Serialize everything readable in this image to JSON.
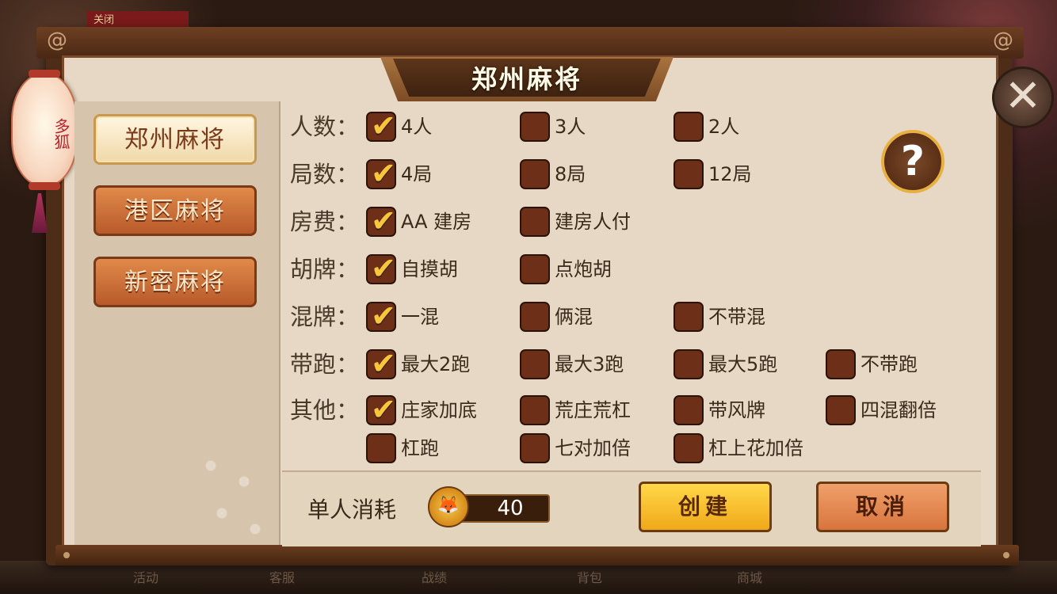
{
  "background": {
    "corner_tab": "关闭",
    "bottom_nav": [
      "活动",
      "客服",
      "战绩",
      "背包",
      "商城"
    ]
  },
  "lantern": {
    "text": "多狐"
  },
  "panel": {
    "title": "郑州麻将",
    "close_symbol": "✕",
    "help_symbol": "?"
  },
  "sidebar": {
    "games": [
      {
        "label": "郑州麻将",
        "active": true
      },
      {
        "label": "港区麻将",
        "active": false
      },
      {
        "label": "新密麻将",
        "active": false
      }
    ]
  },
  "options": [
    {
      "label": "人数：",
      "choices": [
        "4人",
        "3人",
        "2人"
      ],
      "checked": [
        true,
        false,
        false
      ]
    },
    {
      "label": "局数：",
      "choices": [
        "4局",
        "8局",
        "12局"
      ],
      "checked": [
        true,
        false,
        false
      ]
    },
    {
      "label": "房费：",
      "choices": [
        "AA 建房",
        "建房人付"
      ],
      "checked": [
        true,
        false
      ]
    },
    {
      "label": "胡牌：",
      "choices": [
        "自摸胡",
        "点炮胡"
      ],
      "checked": [
        true,
        false
      ]
    },
    {
      "label": "混牌：",
      "choices": [
        "一混",
        "俩混",
        "不带混"
      ],
      "checked": [
        true,
        false,
        false
      ]
    },
    {
      "label": "带跑：",
      "choices": [
        "最大2跑",
        "最大3跑",
        "最大5跑",
        "不带跑"
      ],
      "checked": [
        true,
        false,
        false,
        false
      ]
    },
    {
      "label": "其他：",
      "choices": [
        "庄家加底",
        "荒庄荒杠",
        "带风牌",
        "四混翻倍"
      ],
      "checked": [
        true,
        false,
        false,
        false
      ]
    },
    {
      "label": "",
      "choices": [
        "杠跑",
        "七对加倍",
        "杠上花加倍"
      ],
      "checked": [
        false,
        false,
        false
      ]
    }
  ],
  "footer": {
    "cost_label": "单人消耗",
    "cost_value": "40",
    "create_label": "创建",
    "cancel_label": "取消"
  },
  "colors": {
    "accent_gold": "#f7c63a",
    "checkbox_fill": "#6e2f18",
    "panel_bg": "#e6d8c4",
    "frame_brown": "#4d2c18"
  }
}
